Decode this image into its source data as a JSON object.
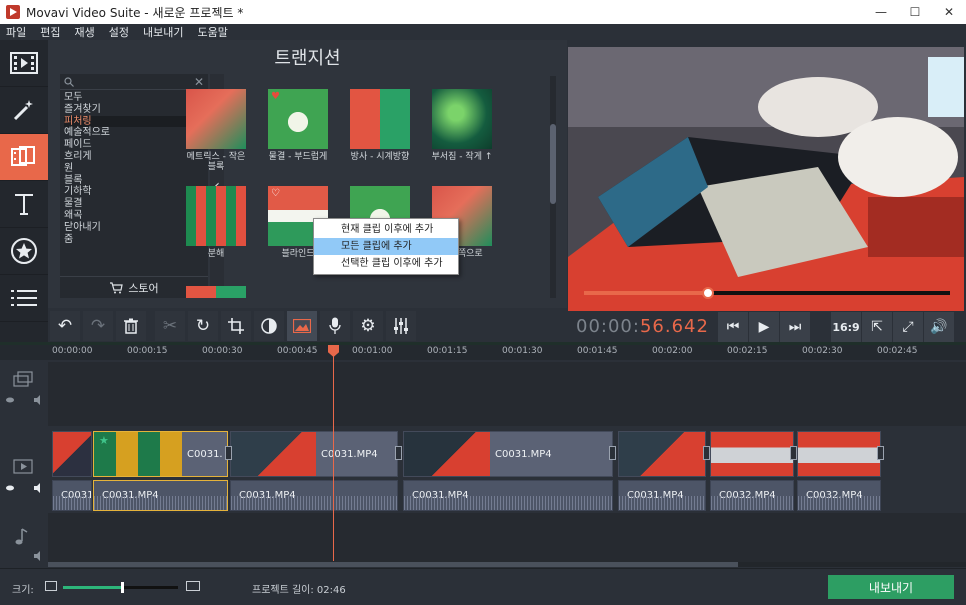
{
  "window": {
    "title": "Movavi Video Suite - 새로운 프로젝트 *",
    "minimize": "—",
    "maximize": "☐",
    "close": "✕"
  },
  "menu": [
    "파일",
    "편집",
    "재생",
    "설정",
    "내보내기",
    "도움말"
  ],
  "sidebar_tools": [
    {
      "icon": "film-icon",
      "glyph": "🎞"
    },
    {
      "icon": "magic-wand-icon",
      "glyph": "✦"
    },
    {
      "icon": "transitions-icon",
      "glyph": "⧉"
    },
    {
      "icon": "titles-icon",
      "glyph": "T"
    },
    {
      "icon": "stickers-icon",
      "glyph": "★"
    },
    {
      "icon": "more-icon",
      "glyph": "☰"
    }
  ],
  "panel": {
    "title": "트랜지션",
    "search_clear": "✕",
    "categories": [
      "모두",
      "즐겨찾기",
      "피처링",
      "예술적으로",
      "페이드",
      "흐리게",
      "원",
      "블록",
      "기하학",
      "물결",
      "왜곡",
      "닫아내기",
      "줌"
    ],
    "selected_category": "피처링",
    "store_label": "스토어",
    "tiles": [
      {
        "label": "메트릭스 - 작은 블록",
        "heart": ""
      },
      {
        "label": "물결 - 부드럽게",
        "heart": "♥"
      },
      {
        "label": "방사 - 시계방향",
        "heart": ""
      },
      {
        "label": "부서짐 - 작게 ↑",
        "heart": ""
      },
      {
        "label": "분해",
        "heart": ""
      },
      {
        "label": "블라인드",
        "heart": "♡"
      },
      {
        "label": "",
        "heart": ""
      },
      {
        "label": "반발쪽으로",
        "heart": ""
      }
    ]
  },
  "context_menu": {
    "items": [
      "현재 클립 이후에 추가",
      "모든 클립에 추가",
      "선택한 클립 이후에 추가"
    ],
    "hovered": 1
  },
  "player": {
    "timecode_dim": "00:00:",
    "timecode_hl": "56.642",
    "progress": 0.34,
    "aspect": "16:9"
  },
  "toolbar_icons": [
    "undo-icon",
    "redo-icon",
    "delete-icon",
    "cut-icon",
    "rotate-icon",
    "crop-icon",
    "color-adjust-icon",
    "pan-zoom-icon",
    "record-audio-icon",
    "settings-icon",
    "equalizer-icon"
  ],
  "ruler_ticks": [
    "00:00:00",
    "00:00:15",
    "00:00:30",
    "00:00:45",
    "00:01:00",
    "00:01:15",
    "00:01:30",
    "00:01:45",
    "00:02:00",
    "00:02:15",
    "00:02:30",
    "00:02:45"
  ],
  "video_clips": [
    {
      "name": "",
      "selected": false
    },
    {
      "name": "C0031.",
      "selected": true
    },
    {
      "name": "C0031.MP4",
      "selected": false
    },
    {
      "name": "C0031.MP4",
      "selected": false
    },
    {
      "name": "",
      "selected": false
    },
    {
      "name": "",
      "selected": false
    },
    {
      "name": "",
      "selected": false
    }
  ],
  "audio_clips": [
    {
      "name": "C0031"
    },
    {
      "name": "C0031.MP4"
    },
    {
      "name": "C0031.MP4"
    },
    {
      "name": "C0031.MP4"
    },
    {
      "name": "C0031.MP4"
    },
    {
      "name": "C0032.MP4"
    },
    {
      "name": "C0032.MP4"
    }
  ],
  "bottom": {
    "zoom_label": "크기:",
    "zoom_level": 0.5,
    "project_length": "프로젝트 길이: 02:46",
    "export_label": "내보내기"
  },
  "colors": {
    "accent": "#e8684a",
    "export_green": "#2d9e63",
    "selection": "#e5b33b"
  }
}
